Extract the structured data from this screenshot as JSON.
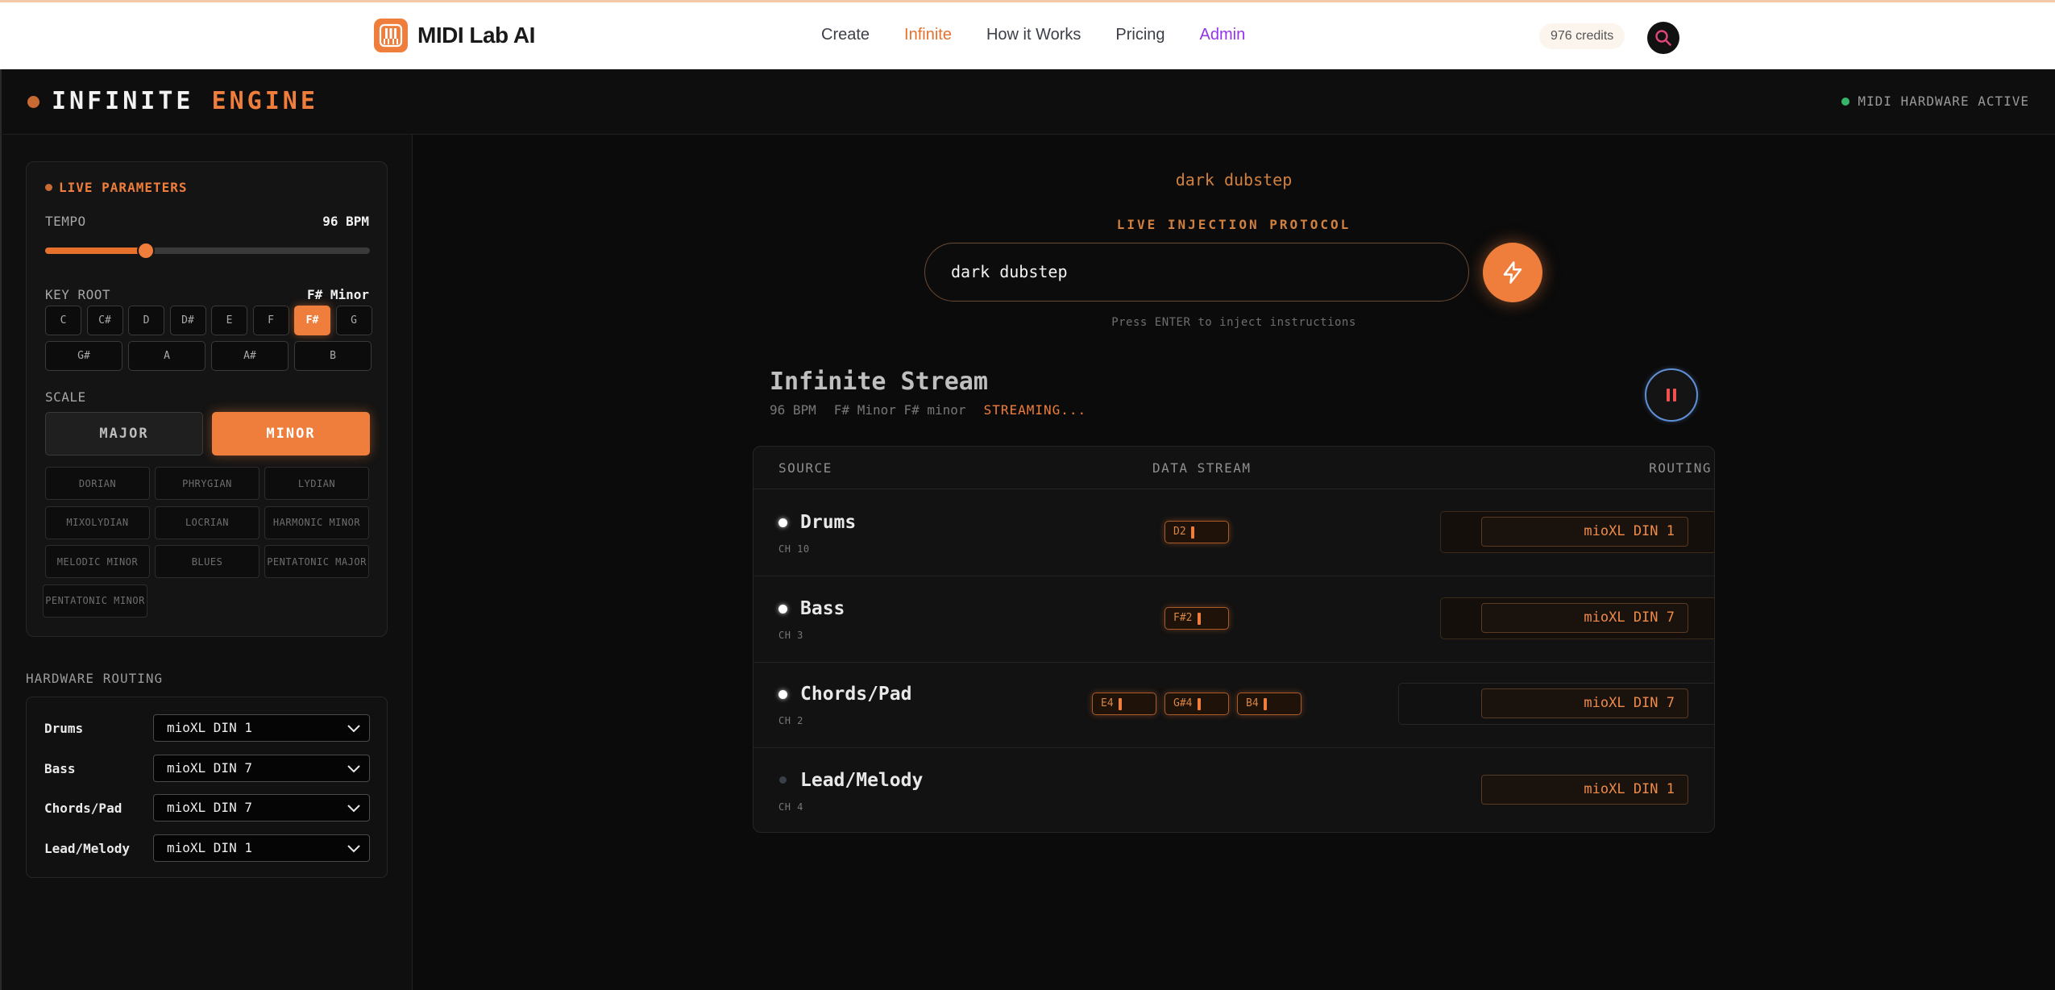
{
  "nav": {
    "brand": "MIDI Lab AI",
    "links": [
      {
        "label": "Create"
      },
      {
        "label": "Infinite"
      },
      {
        "label": "How it Works"
      },
      {
        "label": "Pricing"
      },
      {
        "label": "Admin"
      }
    ],
    "credits": "976 credits"
  },
  "engine": {
    "title_main": "INFINITE",
    "title_accent": "ENGINE",
    "hardware_status": "MIDI HARDWARE ACTIVE"
  },
  "params": {
    "heading": "LIVE PARAMETERS",
    "tempo_label": "TEMPO",
    "tempo_value": "96 BPM",
    "tempo_level_fraction": 0.31,
    "key_label": "KEY ROOT",
    "key_value": "F# Minor",
    "keys_row1": [
      "C",
      "C#",
      "D",
      "D#",
      "E",
      "F",
      "F#",
      "G"
    ],
    "keys_row2": [
      "G#",
      "A",
      "A#",
      "B"
    ],
    "selected_key": "F#",
    "scale_label": "SCALE",
    "scale_major": "MAJOR",
    "scale_minor": "MINOR",
    "modes": [
      "DORIAN",
      "PHRYGIAN",
      "LYDIAN",
      "MIXOLYDIAN",
      "LOCRIAN",
      "HARMONIC MINOR",
      "MELODIC MINOR",
      "BLUES",
      "PENTATONIC MAJOR",
      "PENTATONIC MINOR"
    ]
  },
  "hardware_routing": {
    "heading": "HARDWARE ROUTING",
    "rows": [
      {
        "name": "Drums",
        "port": "mioXL DIN 1"
      },
      {
        "name": "Bass",
        "port": "mioXL DIN 7"
      },
      {
        "name": "Chords/Pad",
        "port": "mioXL DIN 7"
      },
      {
        "name": "Lead/Melody",
        "port": "mioXL DIN 1"
      }
    ]
  },
  "main": {
    "prompt_echo": "dark dubstep",
    "protocol_label": "LIVE INJECTION PROTOCOL",
    "input_value": "dark dubstep",
    "hint": "Press ENTER to inject instructions",
    "stream_title": "Infinite Stream",
    "meta_bpm": "96 BPM",
    "meta_key": "F# Minor F# minor",
    "meta_status": "STREAMING..."
  },
  "table": {
    "headers": {
      "source": "SOURCE",
      "stream": "DATA STREAM",
      "routing": "ROUTING"
    },
    "rows": [
      {
        "name": "Drums",
        "channel": "CH 10",
        "notes": [
          "D2"
        ],
        "route": "mioXL DIN 1",
        "active": true
      },
      {
        "name": "Bass",
        "channel": "CH 3",
        "notes": [
          "F#2"
        ],
        "route": "mioXL DIN 7",
        "active": true
      },
      {
        "name": "Chords/Pad",
        "channel": "CH 2",
        "notes": [
          "E4",
          "G#4",
          "B4"
        ],
        "route": "mioXL DIN 7",
        "active": true
      },
      {
        "name": "Lead/Melody",
        "channel": "CH 4",
        "notes": [],
        "route": "mioXL DIN 1",
        "active": false
      }
    ]
  },
  "colors": {
    "accent": "#ef7e3c",
    "admin": "#9333ea",
    "status_green": "#38b46a"
  }
}
